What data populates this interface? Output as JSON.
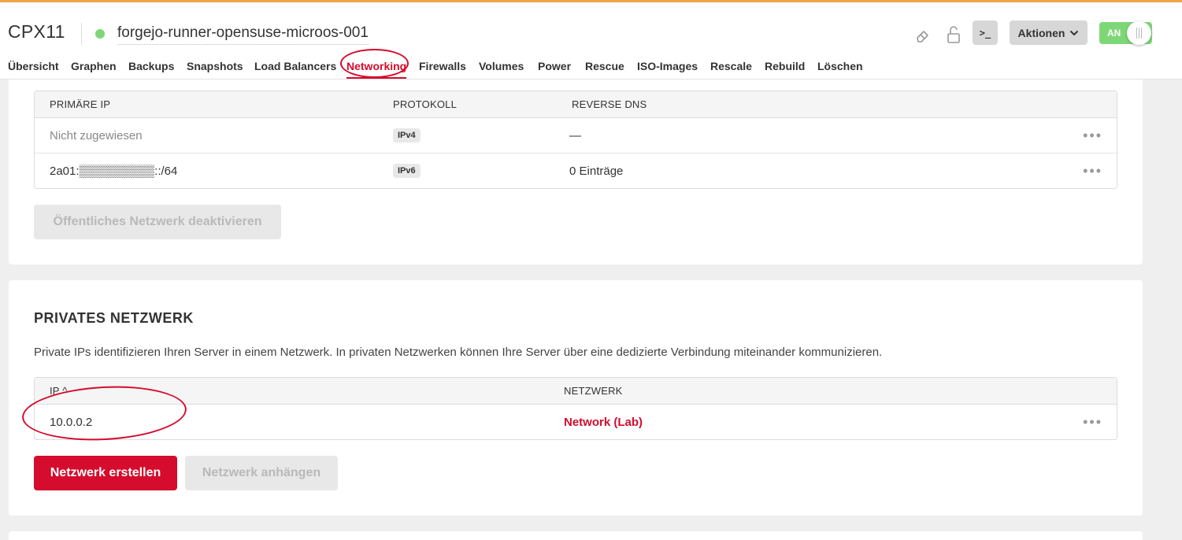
{
  "header": {
    "server_type": "CPX11",
    "server_name": "forgejo-runner-opensuse-microos-001",
    "status_color": "#7ed776",
    "icons": [
      "eraser-icon",
      "lock-icon",
      "console-icon"
    ],
    "console_label": ">_",
    "actions_label": "Aktionen",
    "power_label": "AN"
  },
  "tabs": [
    {
      "label": "Übersicht"
    },
    {
      "label": "Graphen"
    },
    {
      "label": "Backups"
    },
    {
      "label": "Snapshots"
    },
    {
      "label": "Load Balancers"
    },
    {
      "label": "Networking",
      "active": true
    },
    {
      "label": "Firewalls"
    },
    {
      "label": "Volumes"
    },
    {
      "label": "Power"
    },
    {
      "label": "Rescue"
    },
    {
      "label": "ISO-Images"
    },
    {
      "label": "Rescale"
    },
    {
      "label": "Rebuild"
    },
    {
      "label": "Löschen"
    }
  ],
  "public_network": {
    "columns": {
      "ip": "PRIMÄRE IP",
      "protocol": "PROTOKOLL",
      "rdns": "REVERSE DNS"
    },
    "rows": [
      {
        "ip": "Nicht zugewiesen",
        "protocol": "IPv4",
        "rdns": "—"
      },
      {
        "ip": "2a01:▒▒▒▒▒▒▒▒▒::/64",
        "protocol": "IPv6",
        "rdns": "0 Einträge"
      }
    ],
    "deactivate_label": "Öffentliches Netzwerk deaktivieren"
  },
  "private_network": {
    "title": "PRIVATES NETZWERK",
    "description": "Private IPs identifizieren Ihren Server in einem Netzwerk. In privaten Netzwerken können Ihre Server über eine dedizierte Verbindung miteinander kommunizieren.",
    "columns": {
      "ip": "IP ^",
      "network": "NETZWERK"
    },
    "rows": [
      {
        "ip": "10.0.0.2",
        "network": "Network (Lab)"
      }
    ],
    "create_label": "Netzwerk erstellen",
    "attach_label": "Netzwerk anhängen"
  },
  "colors": {
    "accent": "#d50c2d",
    "top_bar": "#f0a54a",
    "status_on": "#7ed776"
  }
}
